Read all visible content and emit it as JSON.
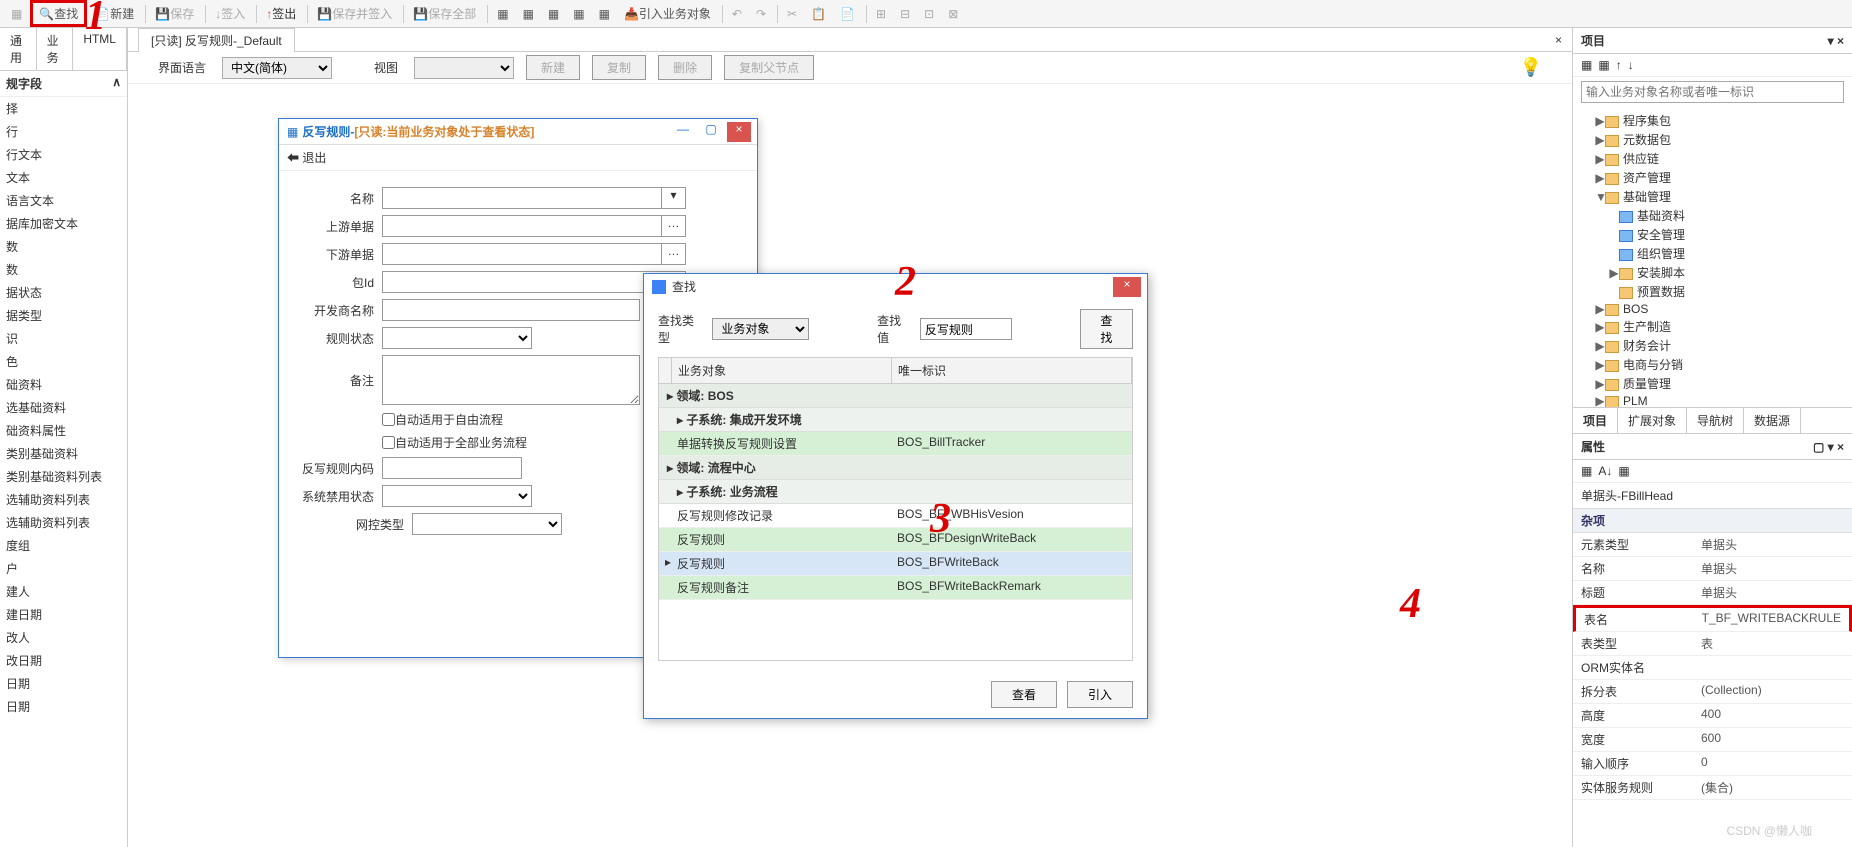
{
  "toolbar": {
    "find": "查找",
    "new": "新建",
    "save": "保存",
    "checkin": "签入",
    "checkout": "签出",
    "save_checkin": "保存并签入",
    "save_all": "保存全部",
    "import_bo": "引入业务对象"
  },
  "left": {
    "tabs": [
      "通用",
      "业务",
      "HTML"
    ],
    "header": "规字段",
    "items": [
      "择",
      "行",
      "行文本",
      "文本",
      "语言文本",
      "据库加密文本",
      "数",
      "数",
      "据状态",
      "据类型",
      "识",
      "色",
      "础资料",
      "选基础资料",
      "础资料属性",
      "类别基础资料",
      "类别基础资料列表",
      "选辅助资料列表",
      "选辅助资料列表",
      "度组",
      "户",
      "建人",
      "建日期",
      "改人",
      "改日期",
      "日期",
      "日期"
    ]
  },
  "doc": {
    "tab_title": "[只读] 反写规则-_Default",
    "lang_label": "界面语言",
    "lang_value": "中文(简体)",
    "view_label": "视图",
    "btn_new": "新建",
    "btn_copy": "复制",
    "btn_delete": "删除",
    "btn_copy_parent": "复制父节点"
  },
  "inner": {
    "title_prefix": "反写规则-",
    "title_warn": "[只读:当前业务对象处于查看状态]",
    "exit": "退出",
    "fields": {
      "name": "名称",
      "upstream": "上游单据",
      "downstream": "下游单据",
      "package": "包Id",
      "dev_name": "开发商名称",
      "rule_status": "规则状态",
      "remark": "备注",
      "auto_free": "自动适用于自由流程",
      "auto_biz": "自动适用于全部业务流程",
      "rule_code": "反写规则内码",
      "sys_disable": "系统禁用状态",
      "net_type": "网控类型"
    }
  },
  "find": {
    "title": "查找",
    "type_label": "查找类型",
    "type_value": "业务对象",
    "value_label": "查找值",
    "value_input": "反写规则",
    "btn_find": "查找",
    "col_bo": "业务对象",
    "col_id": "唯一标识",
    "group1": "领域: BOS",
    "sub1": "子系统: 集成开发环境",
    "row1": {
      "bo": "单据转换反写规则设置",
      "id": "BOS_BillTracker"
    },
    "group2": "领域: 流程中心",
    "sub2": "子系统: 业务流程",
    "row2": {
      "bo": "反写规则修改记录",
      "id": "BOS_BF_WBHisVesion"
    },
    "row3": {
      "bo": "反写规则",
      "id": "BOS_BFDesignWriteBack"
    },
    "row4": {
      "bo": "反写规则",
      "id": "BOS_BFWriteBack"
    },
    "row5": {
      "bo": "反写规则备注",
      "id": "BOS_BFWriteBackRemark"
    },
    "btn_view": "查看",
    "btn_import": "引入"
  },
  "right": {
    "title_project": "项目",
    "search_placeholder": "输入业务对象名称或者唯一标识",
    "tree": [
      {
        "ind": 1,
        "caret": "▶",
        "icon": "f",
        "label": "程序集包"
      },
      {
        "ind": 1,
        "caret": "▶",
        "icon": "f",
        "label": "元数据包"
      },
      {
        "ind": 1,
        "caret": "▶",
        "icon": "f",
        "label": "供应链"
      },
      {
        "ind": 1,
        "caret": "▶",
        "icon": "f",
        "label": "资产管理"
      },
      {
        "ind": 1,
        "caret": "▼",
        "icon": "f",
        "label": "基础管理"
      },
      {
        "ind": 2,
        "caret": "",
        "icon": "b",
        "label": "基础资料"
      },
      {
        "ind": 2,
        "caret": "",
        "icon": "b",
        "label": "安全管理"
      },
      {
        "ind": 2,
        "caret": "",
        "icon": "b",
        "label": "组织管理"
      },
      {
        "ind": 2,
        "caret": "▶",
        "icon": "f",
        "label": "安装脚本"
      },
      {
        "ind": 2,
        "caret": "",
        "icon": "f",
        "label": "预置数据"
      },
      {
        "ind": 1,
        "caret": "▶",
        "icon": "f",
        "label": "BOS"
      },
      {
        "ind": 1,
        "caret": "▶",
        "icon": "f",
        "label": "生产制造"
      },
      {
        "ind": 1,
        "caret": "▶",
        "icon": "f",
        "label": "财务会计"
      },
      {
        "ind": 1,
        "caret": "▶",
        "icon": "f",
        "label": "电商与分销"
      },
      {
        "ind": 1,
        "caret": "▶",
        "icon": "f",
        "label": "质量管理"
      },
      {
        "ind": 1,
        "caret": "▶",
        "icon": "f",
        "label": "PLM"
      }
    ],
    "tabs": [
      "项目",
      "扩展对象",
      "导航树",
      "数据源"
    ],
    "props_title": "属性",
    "props_head": "单据头-FBillHead",
    "props_cat": "杂项",
    "props": [
      {
        "k": "元素类型",
        "v": "单据头"
      },
      {
        "k": "名称",
        "v": "单据头"
      },
      {
        "k": "标题",
        "v": "单据头"
      },
      {
        "k": "表名",
        "v": "T_BF_WRITEBACKRULE"
      },
      {
        "k": "表类型",
        "v": "表"
      },
      {
        "k": "ORM实体名",
        "v": ""
      },
      {
        "k": "拆分表",
        "v": "(Collection)"
      },
      {
        "k": "高度",
        "v": "400"
      },
      {
        "k": "宽度",
        "v": "600"
      },
      {
        "k": "输入顺序",
        "v": "0"
      },
      {
        "k": "实体服务规则",
        "v": "(集合)"
      }
    ]
  },
  "watermark": "CSDN @懒人咖"
}
